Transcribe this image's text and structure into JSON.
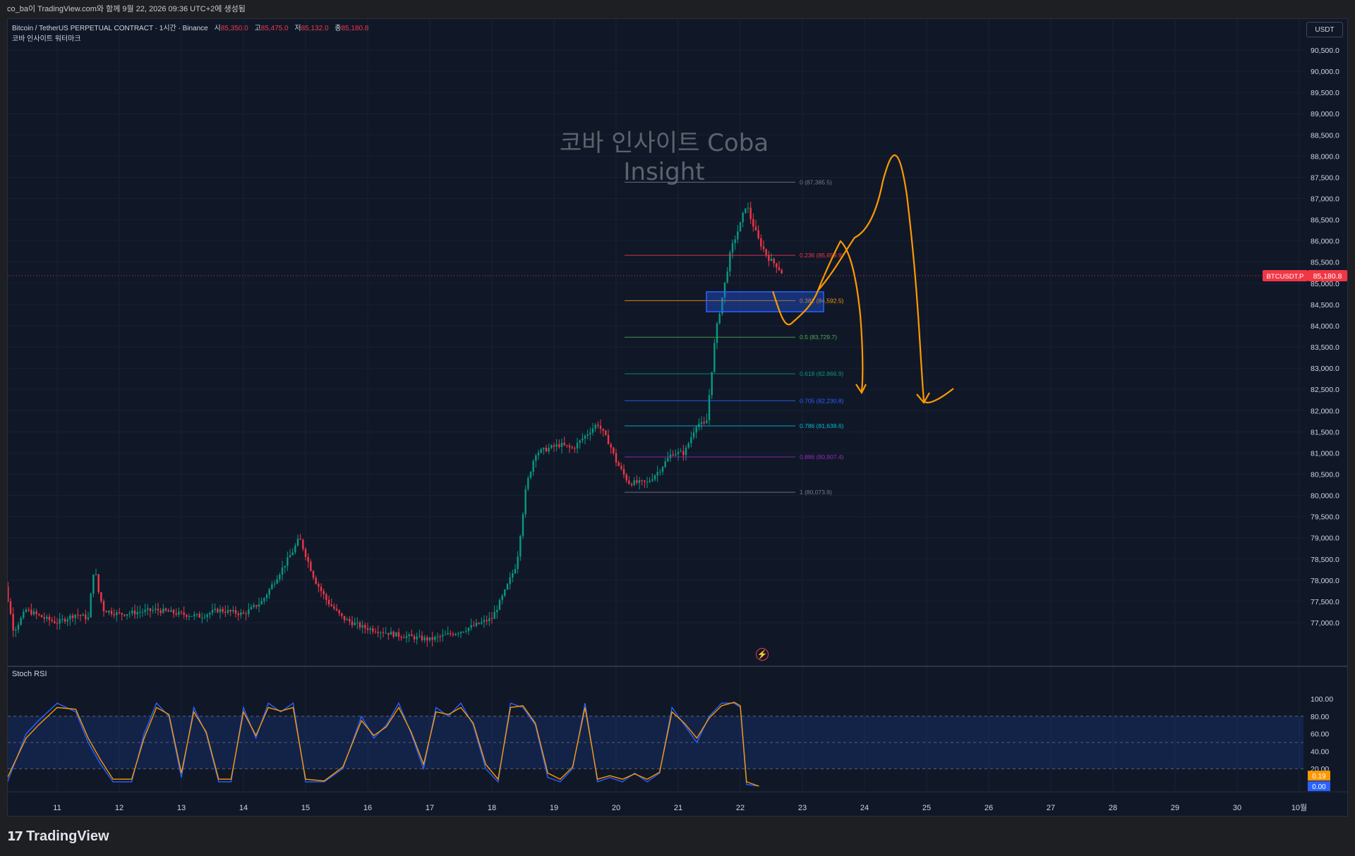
{
  "top_bar": {
    "text": "co_ba이 TradingView.com와 함께 9월 22, 2026 09:36 UTC+2에 생성됨"
  },
  "legend": {
    "symbol": "Bitcoin / TetherUS PERPETUAL CONTRACT · 1시간 · Binance",
    "open_label": "시",
    "open_value": "85,350.0",
    "high_label": "고",
    "high_value": "85,475.0",
    "low_label": "저",
    "low_value": "85,132.0",
    "close_label": "종",
    "close_value": "85,180.8",
    "watermark_label": "코바 인사이트 워터마크"
  },
  "currency": "USDT",
  "watermark": "코바 인사이트 Coba Insight",
  "price_tag": {
    "symbol": "BTCUSDT.P",
    "value": "85,180.8"
  },
  "price_axis_labels": [
    "90,500.0",
    "90,000.0",
    "89,500.0",
    "89,000.0",
    "88,500.0",
    "88,000.0",
    "87,500.0",
    "87,000.0",
    "86,500.0",
    "86,000.0",
    "85,500.0",
    "85,000.0",
    "84,500.0",
    "84,000.0",
    "83,500.0",
    "83,000.0",
    "82,500.0",
    "82,000.0",
    "81,500.0",
    "81,000.0",
    "80,500.0",
    "80,000.0",
    "79,500.0",
    "79,000.0",
    "78,500.0",
    "78,000.0",
    "77,500.0",
    "77,000.0"
  ],
  "fib_levels": [
    {
      "label": "0 (87,385.5)",
      "value": 87385.5,
      "color": "#787b86"
    },
    {
      "label": "0.236 (85,659.9)",
      "value": 85659.9,
      "color": "#f23645"
    },
    {
      "label": "0.382 (84,592.5)",
      "value": 84592.5,
      "color": "#ff9800"
    },
    {
      "label": "0.5 (83,729.7)",
      "value": 83729.7,
      "color": "#4caf50"
    },
    {
      "label": "0.618 (82,866.9)",
      "value": 82866.9,
      "color": "#089981"
    },
    {
      "label": "0.705 (82,230.8)",
      "value": 82230.8,
      "color": "#2962ff"
    },
    {
      "label": "0.786 (81,638.6)",
      "value": 81638.6,
      "color": "#00bcd4"
    },
    {
      "label": "0.886 (80,907.4)",
      "value": 80907.4,
      "color": "#9c27b0"
    },
    {
      "label": "1 (80,073.9)",
      "value": 80073.9,
      "color": "#787b86"
    }
  ],
  "stoch_rsi": {
    "title": "Stoch RSI",
    "axis_labels": [
      "100.00",
      "80.00",
      "60.00",
      "40.00",
      "20.00"
    ],
    "k_value": "0.19",
    "d_value": "0.00"
  },
  "time_axis_labels": [
    "11",
    "12",
    "13",
    "14",
    "15",
    "16",
    "17",
    "18",
    "19",
    "20",
    "21",
    "22",
    "23",
    "24",
    "25",
    "26",
    "27",
    "28",
    "29",
    "30",
    "10월"
  ],
  "chart_data": {
    "type": "candlestick",
    "symbol": "BTCUSDT.P",
    "ylim": [
      76900,
      90700
    ],
    "close_path": [
      [
        10.0,
        78500
      ],
      [
        10.1,
        78300
      ],
      [
        10.2,
        77600
      ],
      [
        10.3,
        76800
      ],
      [
        10.5,
        77300
      ],
      [
        10.8,
        77100
      ],
      [
        11.0,
        77000
      ],
      [
        11.3,
        77200
      ],
      [
        11.5,
        77100
      ],
      [
        11.6,
        78400
      ],
      [
        11.65,
        77800
      ],
      [
        11.75,
        77300
      ],
      [
        12.0,
        77200
      ],
      [
        12.3,
        77250
      ],
      [
        12.6,
        77300
      ],
      [
        13.0,
        77200
      ],
      [
        13.3,
        77150
      ],
      [
        13.6,
        77300
      ],
      [
        14.0,
        77200
      ],
      [
        14.3,
        77500
      ],
      [
        14.55,
        78100
      ],
      [
        14.8,
        78700
      ],
      [
        14.9,
        79000
      ],
      [
        15.0,
        78600
      ],
      [
        15.15,
        78000
      ],
      [
        15.35,
        77500
      ],
      [
        15.6,
        77100
      ],
      [
        15.9,
        76900
      ],
      [
        16.5,
        76700
      ],
      [
        17.0,
        76600
      ],
      [
        17.5,
        76800
      ],
      [
        18.0,
        77100
      ],
      [
        18.2,
        77700
      ],
      [
        18.4,
        78400
      ],
      [
        18.55,
        80200
      ],
      [
        18.7,
        81000
      ],
      [
        18.9,
        81100
      ],
      [
        19.1,
        81200
      ],
      [
        19.3,
        81100
      ],
      [
        19.5,
        81400
      ],
      [
        19.7,
        81700
      ],
      [
        19.9,
        81200
      ],
      [
        20.0,
        80800
      ],
      [
        20.2,
        80300
      ],
      [
        20.5,
        80300
      ],
      [
        20.7,
        80600
      ],
      [
        20.9,
        81000
      ],
      [
        21.1,
        81000
      ],
      [
        21.3,
        81700
      ],
      [
        21.45,
        81650
      ],
      [
        21.6,
        83800
      ],
      [
        21.75,
        85000
      ],
      [
        21.85,
        85800
      ],
      [
        22.0,
        86400
      ],
      [
        22.1,
        86900
      ],
      [
        22.15,
        86600
      ],
      [
        22.3,
        86000
      ],
      [
        22.45,
        85600
      ],
      [
        22.6,
        85400
      ],
      [
        22.7,
        85180.8
      ]
    ],
    "stoch_k_path": [
      [
        10.0,
        40
      ],
      [
        10.2,
        5
      ],
      [
        10.5,
        60
      ],
      [
        10.7,
        75
      ],
      [
        11.0,
        95
      ],
      [
        11.3,
        85
      ],
      [
        11.5,
        50
      ],
      [
        11.7,
        25
      ],
      [
        11.9,
        5
      ],
      [
        12.2,
        5
      ],
      [
        12.4,
        60
      ],
      [
        12.6,
        95
      ],
      [
        12.8,
        80
      ],
      [
        13.0,
        10
      ],
      [
        13.2,
        90
      ],
      [
        13.4,
        60
      ],
      [
        13.6,
        5
      ],
      [
        13.8,
        5
      ],
      [
        14.0,
        90
      ],
      [
        14.2,
        55
      ],
      [
        14.4,
        95
      ],
      [
        14.6,
        85
      ],
      [
        14.8,
        95
      ],
      [
        15.0,
        5
      ],
      [
        15.3,
        5
      ],
      [
        15.6,
        20
      ],
      [
        15.9,
        80
      ],
      [
        16.1,
        55
      ],
      [
        16.3,
        70
      ],
      [
        16.5,
        95
      ],
      [
        16.7,
        60
      ],
      [
        16.9,
        20
      ],
      [
        17.1,
        90
      ],
      [
        17.3,
        80
      ],
      [
        17.5,
        95
      ],
      [
        17.7,
        70
      ],
      [
        17.9,
        20
      ],
      [
        18.1,
        5
      ],
      [
        18.3,
        95
      ],
      [
        18.5,
        90
      ],
      [
        18.7,
        70
      ],
      [
        18.9,
        10
      ],
      [
        19.1,
        5
      ],
      [
        19.3,
        20
      ],
      [
        19.5,
        95
      ],
      [
        19.7,
        5
      ],
      [
        19.9,
        10
      ],
      [
        20.1,
        5
      ],
      [
        20.3,
        15
      ],
      [
        20.5,
        5
      ],
      [
        20.7,
        15
      ],
      [
        20.9,
        90
      ],
      [
        21.1,
        70
      ],
      [
        21.3,
        50
      ],
      [
        21.5,
        80
      ],
      [
        21.7,
        95
      ],
      [
        21.9,
        95
      ],
      [
        22.0,
        90
      ],
      [
        22.1,
        2
      ],
      [
        22.3,
        0.19
      ]
    ],
    "stoch_d_path": [
      [
        10.0,
        45
      ],
      [
        10.2,
        10
      ],
      [
        10.5,
        55
      ],
      [
        10.7,
        70
      ],
      [
        11.0,
        90
      ],
      [
        11.3,
        88
      ],
      [
        11.5,
        55
      ],
      [
        11.7,
        30
      ],
      [
        11.9,
        8
      ],
      [
        12.2,
        8
      ],
      [
        12.4,
        55
      ],
      [
        12.6,
        90
      ],
      [
        12.8,
        82
      ],
      [
        13.0,
        15
      ],
      [
        13.2,
        85
      ],
      [
        13.4,
        62
      ],
      [
        13.6,
        8
      ],
      [
        13.8,
        8
      ],
      [
        14.0,
        85
      ],
      [
        14.2,
        58
      ],
      [
        14.4,
        90
      ],
      [
        14.6,
        86
      ],
      [
        14.8,
        90
      ],
      [
        15.0,
        8
      ],
      [
        15.3,
        6
      ],
      [
        15.6,
        22
      ],
      [
        15.9,
        75
      ],
      [
        16.1,
        58
      ],
      [
        16.3,
        68
      ],
      [
        16.5,
        90
      ],
      [
        16.7,
        62
      ],
      [
        16.9,
        25
      ],
      [
        17.1,
        85
      ],
      [
        17.3,
        82
      ],
      [
        17.5,
        90
      ],
      [
        17.7,
        72
      ],
      [
        17.9,
        25
      ],
      [
        18.1,
        8
      ],
      [
        18.3,
        90
      ],
      [
        18.5,
        92
      ],
      [
        18.7,
        72
      ],
      [
        18.9,
        15
      ],
      [
        19.1,
        8
      ],
      [
        19.3,
        22
      ],
      [
        19.5,
        90
      ],
      [
        19.7,
        8
      ],
      [
        19.9,
        12
      ],
      [
        20.1,
        8
      ],
      [
        20.3,
        14
      ],
      [
        20.5,
        8
      ],
      [
        20.7,
        16
      ],
      [
        20.9,
        85
      ],
      [
        21.1,
        72
      ],
      [
        21.3,
        55
      ],
      [
        21.5,
        78
      ],
      [
        21.7,
        92
      ],
      [
        21.9,
        96
      ],
      [
        22.0,
        92
      ],
      [
        22.1,
        5
      ],
      [
        22.3,
        0.0
      ]
    ]
  },
  "colors": {
    "background": "#101828",
    "bull": "#089981",
    "bear": "#f23645",
    "annotation": "#ff9800",
    "stoch_k": "#2962ff",
    "stoch_d": "#ff9800",
    "zone": "#2962ff"
  },
  "footer": {
    "brand": "TradingView"
  }
}
